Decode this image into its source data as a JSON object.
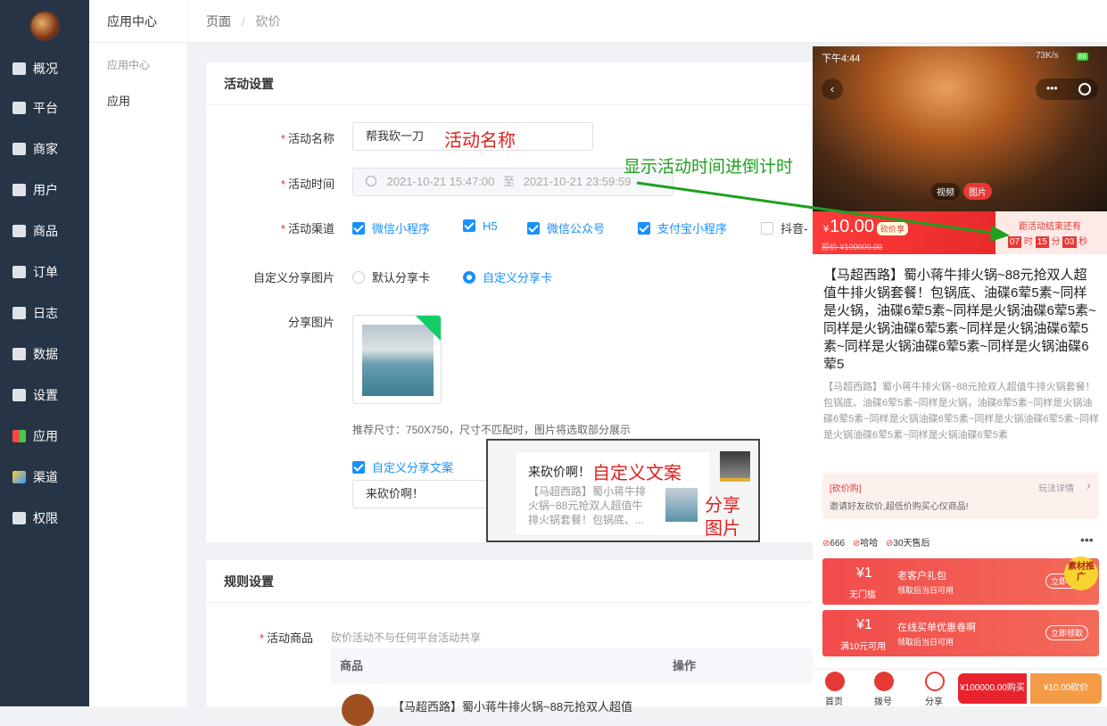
{
  "sidebar": {
    "items": [
      {
        "label": "概况",
        "icon": "chart-icon"
      },
      {
        "label": "平台",
        "icon": "monitor-icon"
      },
      {
        "label": "商家",
        "icon": "store-icon"
      },
      {
        "label": "用户",
        "icon": "user-icon"
      },
      {
        "label": "商品",
        "icon": "goods-icon"
      },
      {
        "label": "订单",
        "icon": "order-icon"
      },
      {
        "label": "日志",
        "icon": "book-icon"
      },
      {
        "label": "数据",
        "icon": "bar-icon"
      },
      {
        "label": "设置",
        "icon": "gear-icon"
      },
      {
        "label": "应用",
        "icon": "grid-icon"
      },
      {
        "label": "渠道",
        "icon": "cube-icon"
      },
      {
        "label": "权限",
        "icon": "lock-icon"
      }
    ]
  },
  "subnav": {
    "title": "应用中心",
    "group": "应用中心",
    "item": "应用"
  },
  "breadcrumb": {
    "root": "页面",
    "sep": "/",
    "current": "砍价"
  },
  "activity": {
    "header": "活动设置",
    "name_label": "活动名称",
    "name_value": "帮我砍一刀",
    "name_note": "活动名称",
    "time_label": "活动时间",
    "start": "2021-10-21 15:47:00",
    "to": "至",
    "end": "2021-10-21 23:59:59",
    "time_note": "显示活动时间进倒计时",
    "channel_label": "活动渠道",
    "channels": [
      {
        "label": "微信小程序",
        "checked": true
      },
      {
        "label": "H5",
        "checked": true
      },
      {
        "label": "微信公众号",
        "checked": true
      },
      {
        "label": "支付宝小程序",
        "checked": true
      },
      {
        "label": "抖音-",
        "checked": false
      }
    ],
    "share_label": "自定义分享图片",
    "share_opt1": "默认分享卡",
    "share_opt2": "自定义分享卡",
    "img_label": "分享图片",
    "img_hint": "推荐尺寸：750X750，尺寸不匹配时，图片将选取部分展示",
    "copy_check": "自定义分享文案",
    "copy_value": "来砍价啊！"
  },
  "preview": {
    "title": "来砍价啊！",
    "note": "自定义文案",
    "desc": "【马超西路】蜀小蒋牛排火锅~88元抢双人超值牛排火锅套餐！包锅底、...",
    "img_note1": "分享",
    "img_note2": "图片"
  },
  "rules": {
    "header": "规则设置",
    "goods_label": "活动商品",
    "goods_note": "砍价活动不与任何平台活动共享",
    "col1": "商品",
    "col2": "操作",
    "row1": "【马超西路】蜀小蒋牛排火锅~88元抢双人超值"
  },
  "phone": {
    "time": "下午4:44",
    "net": "73K/s",
    "battery": "88",
    "tabs": [
      "视频",
      "图片"
    ],
    "price": "10.00",
    "price_sym": "¥",
    "tag": "砍价享",
    "orig": "原价 ¥100000.00",
    "countdown_title": "距活动结束还有",
    "h": "07",
    "hl": "时",
    "m": "15",
    "ml": "分",
    "s": "03",
    "sl": "秒",
    "title": "【马超西路】蜀小蒋牛排火锅~88元抢双人超值牛排火锅套餐！包锅底、油碟6荤5素~同样是火锅，油碟6荤5素~同样是火锅油碟6荤5素~同样是火锅油碟6荤5素~同样是火锅油碟6荤5素~同样是火锅油碟6荤5素~同样是火锅油碟6荤5",
    "desc": "【马超西路】蜀小蒋牛排火锅~88元抢双人超值牛排火锅套餐！包锅底、油碟6荤5素~同样是火锅，油碟6荤5素~同样是火锅油碟6荤5素~同样是火锅油碟6荤5素~同样是火锅油碟6荤5素~同样是火锅油碟6荤5素~同样是火锅油碟6荤5素",
    "rule_tag": "[砍价购]",
    "rule_link": "玩法详情",
    "rule_desc": "邀请好友砍价,超低价购买心仪商品!",
    "stats": [
      "666",
      "哈哈",
      "30天售后"
    ],
    "coupons": [
      {
        "amt": "1",
        "cond": "无门槛",
        "name": "老客户礼包",
        "sub": "领取后当日可用",
        "btn": "立即领取"
      },
      {
        "amt": "1",
        "cond": "满10元可用",
        "name": "在线买单优惠卷啊",
        "sub": "领取后当日可用",
        "btn": "立即领取"
      }
    ],
    "badge": "素材推广",
    "bottom": [
      "首页",
      "拨号",
      "分享"
    ],
    "buy": "¥100000.00购买",
    "bargain": "¥10.00砍价"
  }
}
